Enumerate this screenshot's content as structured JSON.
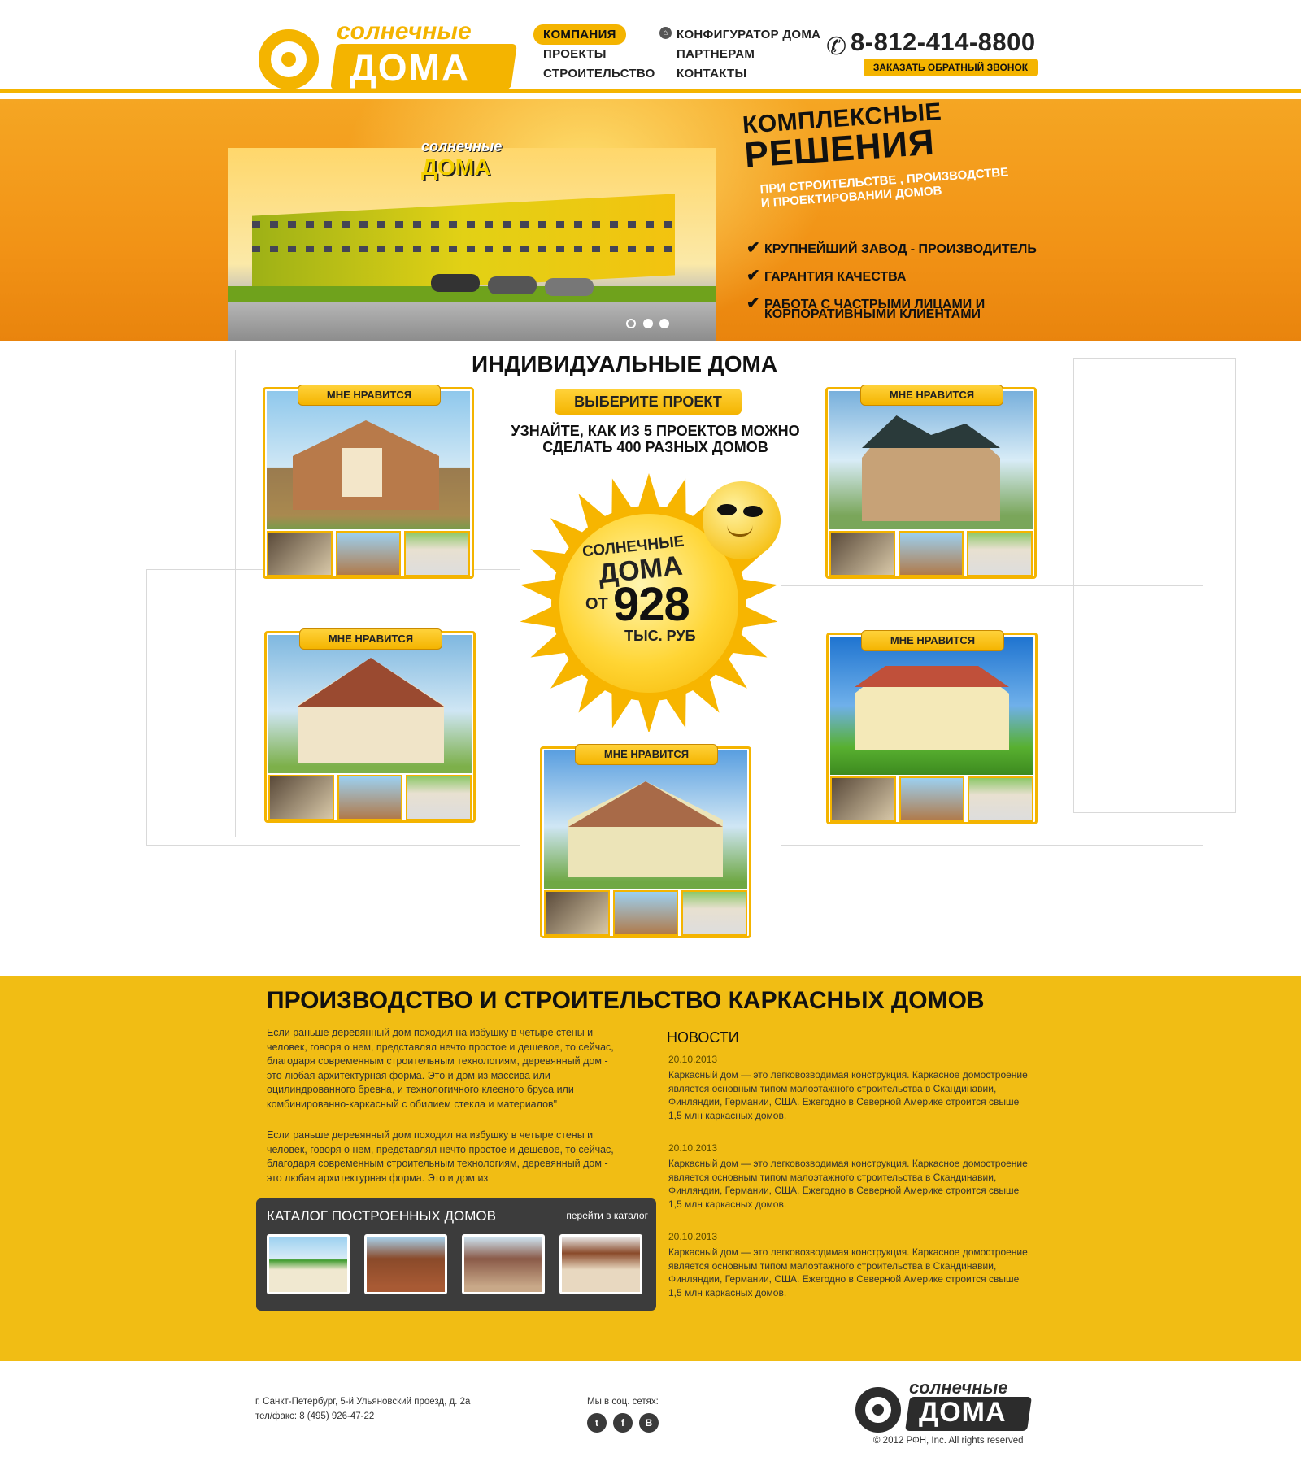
{
  "header": {
    "logo_top": "солнечные",
    "logo_bottom": "ДОМА",
    "nav_col1": [
      "КОМПАНИЯ",
      "ПРОЕКТЫ",
      "СТРОИТЕЛЬСТВО"
    ],
    "nav_col2": [
      "КОНФИГУРАТОР ДОМА",
      "ПАРТНЕРАМ",
      "КОНТАКТЫ"
    ],
    "phone": "8-812-414-8800",
    "callback_label": "ЗАКАЗАТЬ ОБРАТНЫЙ ЗВОНОК"
  },
  "banner": {
    "building_logo_top": "солнечные",
    "building_logo_bottom": "ДОМА",
    "headline1": "КОМПЛЕКСНЫЕ",
    "headline2": "РЕШЕНИЯ",
    "sub1": "ПРИ СТРОИТЕЛЬСТВЕ , ПРОИЗВОДСТВЕ",
    "sub2": "И ПРОЕКТИРОВАНИИ ДОМОВ",
    "features": [
      "КРУПНЕЙШИЙ ЗАВОД - ПРОИЗВОДИТЕЛЬ",
      "ГАРАНТИЯ КАЧЕСТВА",
      "РАБОТА С ЧАСТРЫМИ ЛИЦАМИ И",
      "КОРПОРАТИВНЫМИ КЛИЕНТАМИ"
    ],
    "slides_total": 3,
    "slide_active": 1
  },
  "projects": {
    "title": "ИНДИВИДУАЛЬНЫЕ ДОМА",
    "choose_label": "ВЫБЕРИТЕ ПРОЕКТ",
    "tagline1": "УЗНАЙТЕ, КАК ИЗ 5 ПРОЕКТОВ МОЖНО",
    "tagline2": "СДЕЛАТЬ 400 РАЗНЫХ ДОМОВ",
    "like_label": "МНЕ НРАВИТСЯ",
    "sun_line1": "СОЛНЕЧНЫЕ",
    "sun_line2": "ДОМА",
    "sun_prefix": "ОТ",
    "sun_price": "928",
    "sun_unit": "ТЫС. РУБ"
  },
  "info": {
    "title": "ПРОИЗВОДСТВО И СТРОИТЕЛЬСТВО КАРКАСНЫХ ДОМОВ",
    "para1": "Если раньше деревянный дом походил на избушку в четыре стены и человек, говоря о нем, представлял нечто простое и дешевое, то сейчас, благодаря современным строительным технологиям, деревянный дом - это любая архитектурная форма. Это и дом из массива или оцилиндрованного бревна, и технологичного клееного бруса или комбинированно-каркасный с обилием стекла и материалов\"",
    "para2": "Если раньше деревянный дом походил на избушку в четыре стены и человек, говоря о нем, представлял нечто простое и дешевое, то сейчас, благодаря современным строительным технологиям, деревянный дом - это любая архитектурная форма. Это и дом из",
    "news_title": "НОВОСТИ",
    "news": [
      {
        "date": "20.10.2013",
        "text": "Каркасный дом — это легковозводимая конструкция. Каркасное домостроение является основным типом малоэтажного строительства в Скандинавии, Финляндии, Германии, США. Ежегодно в Северной Америке строится свыше 1,5 млн каркасных домов."
      },
      {
        "date": "20.10.2013",
        "text": "Каркасный дом — это легковозводимая конструкция. Каркасное домостроение является основным типом малоэтажного строительства в Скандинавии, Финляндии, Германии, США. Ежегодно в Северной Америке строится свыше 1,5 млн каркасных домов."
      },
      {
        "date": "20.10.2013",
        "text": "Каркасный дом — это легковозводимая конструкция. Каркасное домостроение является основным типом малоэтажного строительства в Скандинавии, Финляндии, Германии, США. Ежегодно в Северной Америке строится свыше 1,5 млн каркасных домов."
      }
    ],
    "catalog_title": "КАТАЛОГ ПОСТРОЕННЫХ ДОМОВ",
    "catalog_link": "перейти в каталог"
  },
  "footer": {
    "address": "г. Санкт-Петербург, 5-й Ульяновский проезд, д. 2а",
    "phone": "тел/факс: 8 (495) 926-47-22",
    "social_label": "Мы в соц. сетях:",
    "social": [
      "twitter-icon",
      "facebook-icon",
      "blogger-icon"
    ],
    "logo_top": "солнечные",
    "logo_bottom": "ДОМА",
    "copyright": "© 2012 РФН, Inc. All rights reserved"
  },
  "colors": {
    "accent": "#f4b400",
    "banner": "#f29316",
    "yellow_section": "#f1bd14",
    "dark": "#3c3c3c"
  }
}
